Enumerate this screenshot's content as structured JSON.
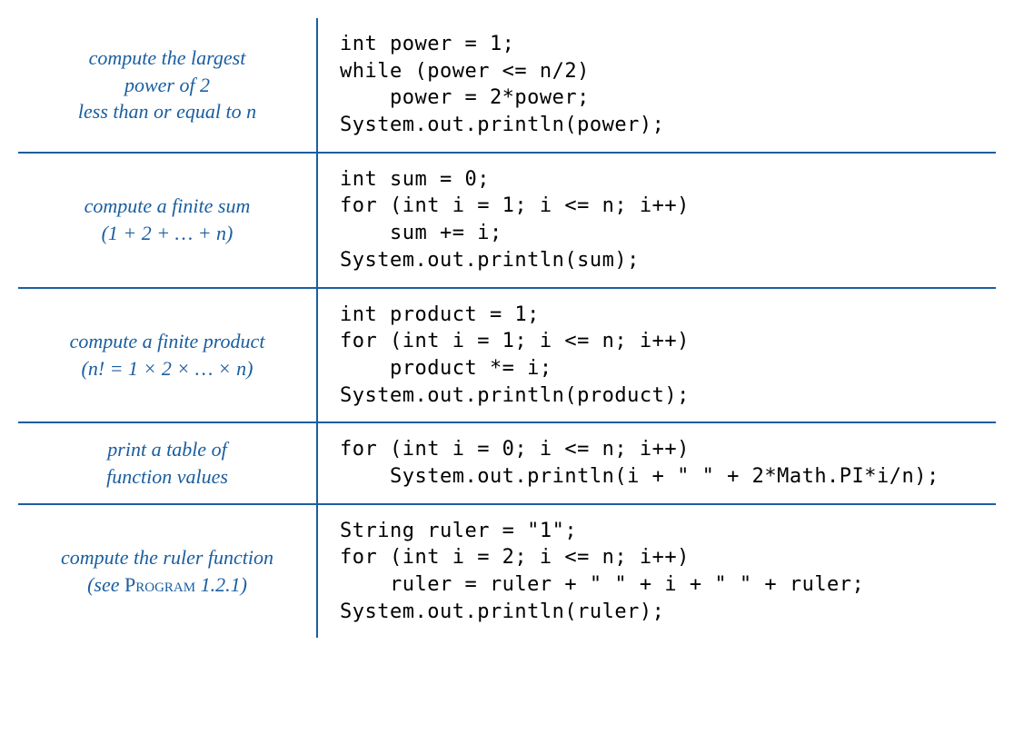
{
  "rows": [
    {
      "desc": "compute the largest<br>power of 2<br>less than or equal to n",
      "code": "int power = 1;\nwhile (power <= n/2)\n    power = 2*power;\nSystem.out.println(power);"
    },
    {
      "desc": "compute a finite sum<br>(1 + 2 + … + n)",
      "code": "int sum = 0;\nfor (int i = 1; i <= n; i++)\n    sum += i;\nSystem.out.println(sum);"
    },
    {
      "desc": "compute a finite product<br>(n! = 1 × 2 ×  … × n)",
      "code": "int product = 1;\nfor (int i = 1; i <= n; i++)\n    product *= i;\nSystem.out.println(product);"
    },
    {
      "desc": "print a table of<br>function values",
      "code": "for (int i = 0; i <= n; i++)\n    System.out.println(i + \" \" + 2*Math.PI*i/n);"
    },
    {
      "desc": "compute the ruler function<br>(see <span class=\"sc\">Program</span> 1.2.1)",
      "code": "String ruler = \"1\";\nfor (int i = 2; i <= n; i++)\n    ruler = ruler + \" \" + i + \" \" + ruler;\nSystem.out.println(ruler);"
    }
  ]
}
